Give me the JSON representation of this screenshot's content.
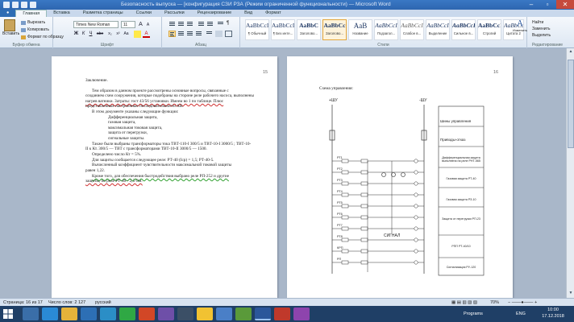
{
  "window": {
    "title": "Безопасность выпуска — [конфигурация СЗИ РЗА (Режим ограниченной функциональности) — Microsoft Word",
    "min_glyph": "–",
    "max_glyph": "▫",
    "close_glyph": "✕"
  },
  "ribbon_tabs": [
    "Главная",
    "Вставка",
    "Разметка страницы",
    "Ссылки",
    "Рассылки",
    "Рецензирование",
    "Вид",
    "Формат"
  ],
  "active_tab_index": 0,
  "clipboard": {
    "paste": "Вставить",
    "cut": "Вырезать",
    "copy": "Копировать",
    "format_painter": "Формат по образцу",
    "label": "Буфер обмена"
  },
  "font": {
    "family": "Times New Roman",
    "size": "11",
    "label": "Шрифт",
    "bold": "Ж",
    "italic": "К",
    "underline": "Ч",
    "strike": "abe",
    "sub": "x₂",
    "sup": "x²",
    "case": "Aa",
    "color": "A",
    "grow": "A",
    "shrink": "A"
  },
  "paragraph": {
    "label": "Абзац"
  },
  "styles": {
    "label": "Стили",
    "items": [
      {
        "sample": "AaBbCcI",
        "name": "¶ Обычный"
      },
      {
        "sample": "AaBbCcI",
        "name": "¶ Без инте..."
      },
      {
        "sample": "AaBbC",
        "name": "Заголово..."
      },
      {
        "sample": "AaBbCc",
        "name": "Заголово..."
      },
      {
        "sample": "AaB",
        "name": "Название"
      },
      {
        "sample": "AaBbCcI",
        "name": "Подзагол..."
      },
      {
        "sample": "AaBbCcI",
        "name": "Слабое в..."
      },
      {
        "sample": "AaBbCcI",
        "name": "Выделение"
      },
      {
        "sample": "AaBbCcI",
        "name": "Сильное в..."
      },
      {
        "sample": "AaBbCcI",
        "name": "Строгий"
      },
      {
        "sample": "AaBbCcI",
        "name": "Цитата 2"
      }
    ],
    "selected_index": 3,
    "change_styles": "Изменить стили"
  },
  "editing": {
    "find": "Найти",
    "replace": "Заменить",
    "select": "Выделить",
    "label": "Редактирование"
  },
  "left_page": {
    "page_number": "15",
    "lines": [
      "Заключение.",
      "Тем образом в данном проекте рассмотрены основные вопросы, связанные с",
      "созданием схем сооружения, которые подобраны на стороне реле рабочего насоса, выполнены",
      "нагрев ватники. Затраты: гост 43/56 установки. Имеем во 1 по таблице. Плюс",
      "представленные настроенные последовательности АВ.",
      "В этом документе указаны следующие функции:",
      "Дифференциальная защита,",
      "газовая защита,",
      "максимальная токовая защита,",
      "защита от перегрузки,",
      "сигнальные защиты.",
      "Также были выбраны трансформаторы тока ТВТ-110-I 300/5 и ТВТ-10-I 3000/5 ; ТВТ-10-",
      "II к Кт. 300/5 — ТВТ с трансформаторами ТВТ-10-II 3000/5 — 1500.",
      "Определено число Кт = 5%.",
      "Для защиты сообщается следующее реле: РТ-40 (Iср) = 1,5; РТ-40-5.",
      "Вычисленный коэффициент чувствительности максимальной токовой защиты",
      "равен 1,22.",
      "Кроме того, для обеспечения быстродействия выбрано реле РП-252 и другие",
      "защиты, по реле РТ-40 - 2,5 Ом."
    ]
  },
  "right_page": {
    "page_number": "16",
    "heading": "Схема управления:",
    "bus_left": "+ШУ",
    "bus_right": "-ШУ",
    "side_labels": [
      "Шины управления",
      "Приводы-отказ",
      "Дифференциальная защита выполнена на реле РНТ-565",
      "Газовая защита РТ-40",
      "Газовая защита РЗ-10",
      "Защита от перегрузки РП-23",
      "РПП РТ-40/10",
      "Сигнализация РУ-120"
    ],
    "contact_labels": [
      "РТ1",
      "РТ2",
      "РТ3",
      "РТ4",
      "РТ5",
      "РТ6",
      "РТ7",
      "РТ8",
      "КРП",
      "РП"
    ],
    "signal_label": "СИГНАЛ"
  },
  "statusbar": {
    "page": "Страница: 16 из 17",
    "words": "Число слов: 2 127",
    "lang": "русский",
    "zoom": "70%"
  },
  "taskbar": {
    "tray_lang": "ENG",
    "tray_label": "Programs",
    "time": "10:00",
    "date": "17.12.2018"
  }
}
